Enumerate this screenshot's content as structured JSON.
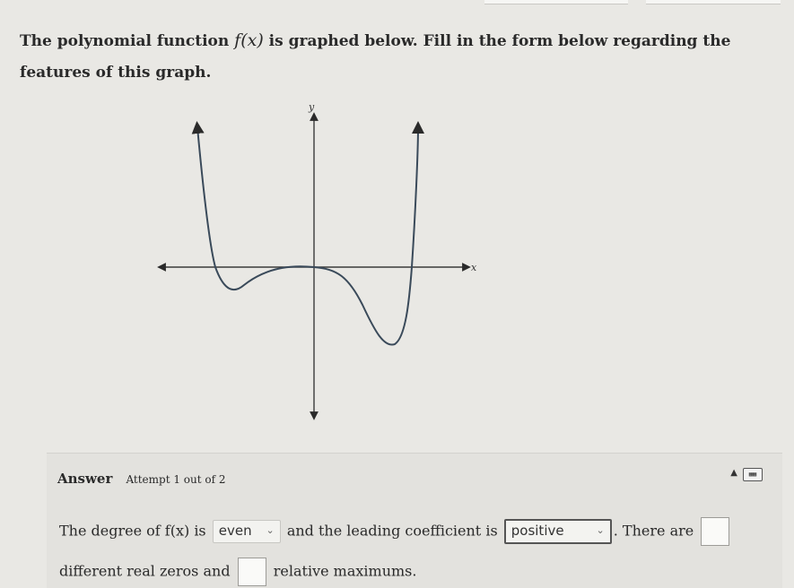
{
  "question": {
    "text_before": "The polynomial function",
    "function_name": "f(x)",
    "text_after": "is graphed below. Fill in the form below regarding the features of this graph."
  },
  "graph": {
    "x_label": "x",
    "y_label": "y"
  },
  "answer": {
    "title": "Answer",
    "attempt": "Attempt 1 out of 2",
    "keypad_icon": "keypad-icon",
    "line1_part1": "The degree of f(x) is",
    "degree_value": "even",
    "line1_part2": "and the leading coefficient is",
    "coefficient_value": "positive",
    "line1_part3": ". There are",
    "zeros_value": "",
    "line2_part1": "different real zeros and",
    "maximums_value": "",
    "line2_part2": "relative maximums."
  },
  "colors": {
    "page_background": "#e9e8e4",
    "curve": "#3a4a5a"
  }
}
